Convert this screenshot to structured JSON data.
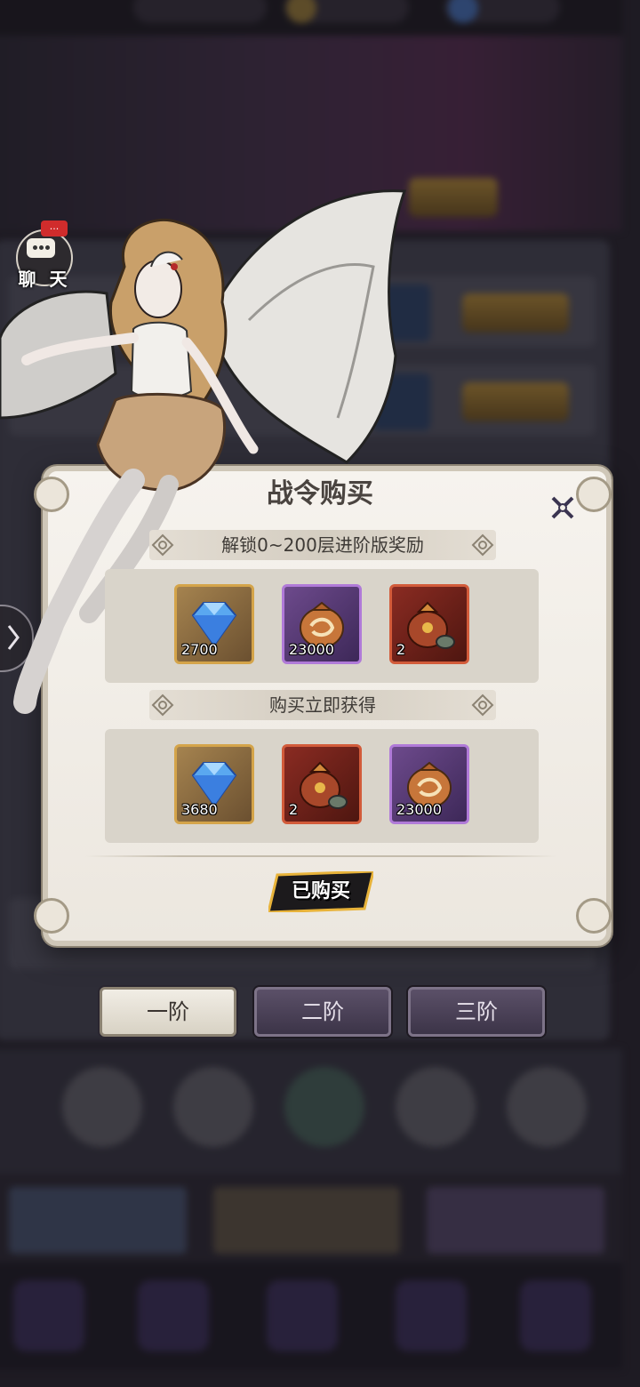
{
  "chat": {
    "label": "聊 天",
    "badge": "..."
  },
  "modal": {
    "title": "战令购买",
    "section1": {
      "label": "解锁0~200层进阶版奖励",
      "items": [
        {
          "icon": "diamond-icon",
          "count": "2700",
          "rarity": "gold"
        },
        {
          "icon": "gold-pouch-icon",
          "count": "23000",
          "rarity": "purple"
        },
        {
          "icon": "treasure-sack-icon",
          "count": "2",
          "rarity": "red"
        }
      ]
    },
    "section2": {
      "label": "购买立即获得",
      "items": [
        {
          "icon": "diamond-icon",
          "count": "3680",
          "rarity": "gold"
        },
        {
          "icon": "treasure-sack-icon",
          "count": "2",
          "rarity": "red"
        },
        {
          "icon": "gold-pouch-icon",
          "count": "23000",
          "rarity": "purple"
        }
      ]
    },
    "status_button": "已购买"
  },
  "tabs": [
    {
      "label": "一阶",
      "active": true
    },
    {
      "label": "二阶",
      "active": false
    },
    {
      "label": "三阶",
      "active": false
    }
  ],
  "colors": {
    "modal_bg": "#f3efe8",
    "accent_gold": "#e8b33a",
    "rarity_gold": "#d4a44a",
    "rarity_purple": "#b07ad8",
    "rarity_red": "#d25b3a"
  }
}
